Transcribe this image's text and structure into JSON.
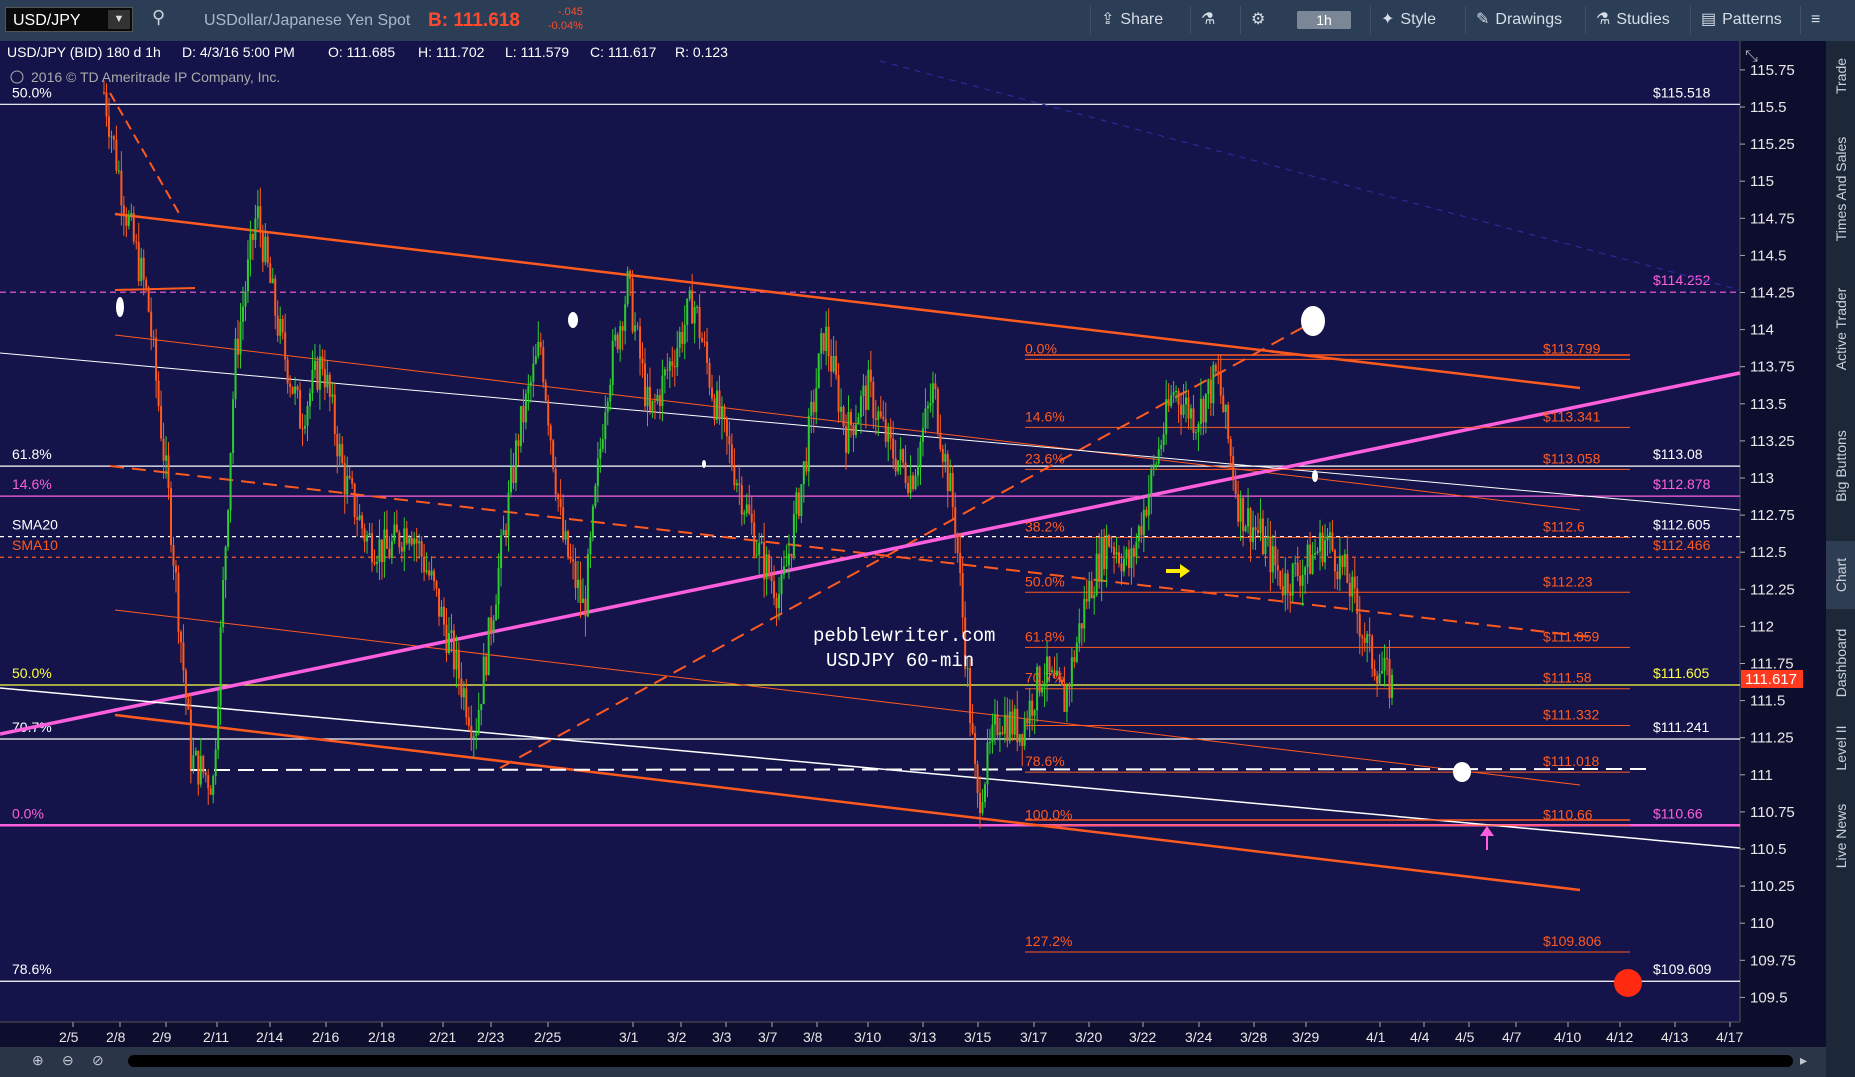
{
  "toolbar": {
    "symbol": "USD/JPY",
    "description": "USDollar/Japanese Yen Spot",
    "bid": "B: 111.618",
    "change": "-.045",
    "change_pct": "-0.04%",
    "share": "Share",
    "timeframe": "1h",
    "style": "Style",
    "drawings": "Drawings",
    "studies": "Studies",
    "patterns": "Patterns"
  },
  "header_info": {
    "series": "USD/JPY (BID) 180 d 1h",
    "date": "D: 4/3/16 5:00 PM",
    "open": "O: 111.685",
    "high": "H: 111.702",
    "low": "L: 111.579",
    "close": "C: 111.617",
    "range": "R: 0.123",
    "copyright": "2016 © TD Ameritrade IP Company, Inc."
  },
  "watermark": {
    "line1": "pebblewriter.com",
    "line2": "USDJPY 60-min"
  },
  "colors": {
    "background": "#14144a",
    "fib": "#ff5a1f",
    "trend_magenta": "#ff5fdc",
    "candle_up": "#2ecc2e",
    "candle_down": "#ff5a1f",
    "price_badge": "#ff3a1f",
    "level_white": "#ffffff",
    "level_yellow": "#ffff44"
  },
  "sidebar": [
    "Trade",
    "Times And Sales",
    "Active Trader",
    "Big Buttons",
    "Chart",
    "Dashboard",
    "Level II",
    "Live News"
  ],
  "sidebar_active": "Chart",
  "chart_data": {
    "type": "candlestick",
    "symbol": "USD/JPY",
    "interval": "60-min",
    "y_range": [
      109.25,
      115.85
    ],
    "y_ticks": [
      "115.75",
      "115.5",
      "115.25",
      "115",
      "114.75",
      "114.5",
      "114.25",
      "114",
      "113.75",
      "113.5",
      "113.25",
      "113",
      "112.75",
      "112.5",
      "112.25",
      "112",
      "111.75",
      "111.5",
      "111.25",
      "111",
      "110.75",
      "110.5",
      "110.25",
      "110",
      "109.75",
      "109.5"
    ],
    "x_ticks": [
      "2/5",
      "2/8",
      "2/9",
      "2/11",
      "2/14",
      "2/16",
      "2/18",
      "2/21",
      "2/23",
      "2/25",
      "3/1",
      "3/2",
      "3/3",
      "3/7",
      "3/8",
      "3/10",
      "3/13",
      "3/15",
      "3/17",
      "3/20",
      "3/22",
      "3/24",
      "3/28",
      "3/29",
      "4/1",
      "4/4",
      "4/5",
      "4/7",
      "4/10",
      "4/12",
      "4/13",
      "4/17"
    ],
    "price_path": [
      [
        0,
        115.6
      ],
      [
        2,
        114.8
      ],
      [
        4,
        114.2
      ],
      [
        6,
        112.8
      ],
      [
        8,
        111.1
      ],
      [
        10,
        110.95
      ],
      [
        12,
        113.8
      ],
      [
        14,
        114.8
      ],
      [
        16,
        114.0
      ],
      [
        18,
        113.4
      ],
      [
        20,
        113.8
      ],
      [
        22,
        113.0
      ],
      [
        24,
        112.6
      ],
      [
        26,
        112.5
      ],
      [
        28,
        112.7
      ],
      [
        30,
        112.3
      ],
      [
        32,
        111.8
      ],
      [
        34,
        111.3
      ],
      [
        36,
        112.3
      ],
      [
        38,
        113.3
      ],
      [
        40,
        113.9
      ],
      [
        42,
        112.6
      ],
      [
        44,
        112.1
      ],
      [
        46,
        113.6
      ],
      [
        48,
        114.3
      ],
      [
        50,
        113.4
      ],
      [
        52,
        113.8
      ],
      [
        54,
        114.2
      ],
      [
        56,
        113.5
      ],
      [
        58,
        113.0
      ],
      [
        60,
        112.5
      ],
      [
        62,
        112.2
      ],
      [
        64,
        113.0
      ],
      [
        66,
        114.0
      ],
      [
        68,
        113.3
      ],
      [
        70,
        113.6
      ],
      [
        72,
        113.2
      ],
      [
        74,
        113.0
      ],
      [
        76,
        113.6
      ],
      [
        78,
        112.7
      ],
      [
        80,
        110.8
      ],
      [
        82,
        111.4
      ],
      [
        84,
        111.3
      ],
      [
        86,
        111.7
      ],
      [
        88,
        111.5
      ],
      [
        90,
        112.2
      ],
      [
        92,
        112.6
      ],
      [
        94,
        112.4
      ],
      [
        96,
        113.0
      ],
      [
        98,
        113.6
      ],
      [
        100,
        113.4
      ],
      [
        102,
        113.7
      ],
      [
        104,
        112.8
      ],
      [
        106,
        112.6
      ],
      [
        108,
        112.3
      ],
      [
        110,
        112.4
      ],
      [
        112,
        112.6
      ],
      [
        114,
        112.3
      ],
      [
        116,
        111.8
      ],
      [
        118,
        111.6
      ]
    ],
    "last_price": "111.617",
    "fib_levels": [
      {
        "label": "0.0%",
        "price": "$113.799"
      },
      {
        "label": "14.6%",
        "price": "$113.341"
      },
      {
        "label": "23.6%",
        "price": "$113.058"
      },
      {
        "label": "38.2%",
        "price": "$112.6"
      },
      {
        "label": "50.0%",
        "price": "$112.23"
      },
      {
        "label": "61.8%",
        "price": "$111.859"
      },
      {
        "label": "70.7%",
        "price": "$111.58"
      },
      {
        "label": "",
        "price": "$111.332"
      },
      {
        "label": "78.6%",
        "price": "$111.018"
      },
      {
        "label": "100.0%",
        "price": "$110.66"
      },
      {
        "label": "127.2%",
        "price": "$109.806"
      }
    ],
    "horizontal_levels": [
      {
        "label": "50.0%",
        "price": "$115.518"
      },
      {
        "label": "",
        "price": "$114.252"
      },
      {
        "label": "61.8%",
        "price": "$113.08"
      },
      {
        "label": "14.6%",
        "price": "$112.878"
      },
      {
        "label": "SMA20",
        "price": "$112.605"
      },
      {
        "label": "SMA10",
        "price": "$112.466"
      },
      {
        "label": "50.0%",
        "price": "$111.605"
      },
      {
        "label": "70.7%",
        "price": "$111.241"
      },
      {
        "label": "0.0%",
        "price": "$110.66"
      },
      {
        "label": "78.6%",
        "price": "$109.609"
      }
    ]
  }
}
